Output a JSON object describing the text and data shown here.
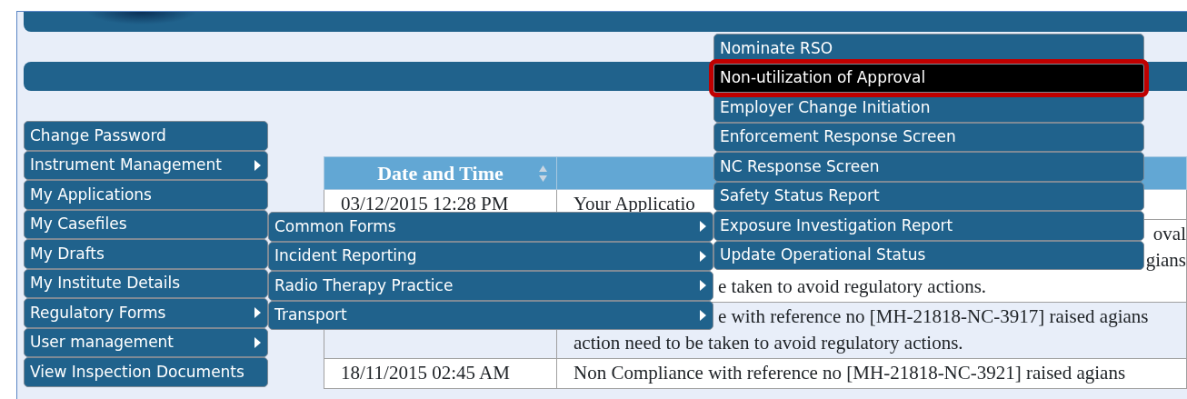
{
  "left_menu": [
    {
      "label": "Change Password",
      "has_submenu": false
    },
    {
      "label": "Instrument Management",
      "has_submenu": true
    },
    {
      "label": "My Applications",
      "has_submenu": false
    },
    {
      "label": "My Casefiles",
      "has_submenu": false
    },
    {
      "label": "My Drafts",
      "has_submenu": false
    },
    {
      "label": "My Institute Details",
      "has_submenu": false
    },
    {
      "label": "Regulatory Forms",
      "has_submenu": true
    },
    {
      "label": "User management",
      "has_submenu": true
    },
    {
      "label": "View Inspection Documents",
      "has_submenu": false
    }
  ],
  "submenu": [
    {
      "label": "Common Forms",
      "has_submenu": true
    },
    {
      "label": "Incident Reporting",
      "has_submenu": true
    },
    {
      "label": "Radio Therapy Practice",
      "has_submenu": true
    },
    {
      "label": "Transport",
      "has_submenu": true
    }
  ],
  "flyout": [
    {
      "label": "Nominate RSO",
      "selected": false
    },
    {
      "label": "Non-utilization of Approval",
      "selected": true
    },
    {
      "label": "Employer Change Initiation",
      "selected": false
    },
    {
      "label": "Enforcement Response Screen",
      "selected": false
    },
    {
      "label": "NC Response Screen",
      "selected": false
    },
    {
      "label": "Safety Status Report",
      "selected": false
    },
    {
      "label": "Exposure Investigation Report",
      "selected": false
    },
    {
      "label": "Update Operational Status",
      "selected": false
    }
  ],
  "table": {
    "columns": [
      {
        "label": "Date and Time",
        "sortable": true
      }
    ],
    "rows": [
      {
        "date": "03/12/2015 12:28 PM",
        "shaded": false,
        "message_lines": [
          {
            "kind": "full",
            "text": "Your Applicatio"
          }
        ]
      },
      {
        "shaded": false,
        "message_lines": [
          {
            "kind": "end",
            "text": "oval"
          },
          {
            "kind": "end",
            "text": "gians"
          },
          {
            "kind": "after_menu",
            "text": "e taken to avoid regulatory actions."
          }
        ]
      },
      {
        "shaded": true,
        "message_lines": [
          {
            "kind": "after_menu",
            "text": "e with reference no [MH-21818-NC-3917] raised agians"
          },
          {
            "kind": "full",
            "text": "action need to be taken to avoid regulatory actions."
          }
        ]
      },
      {
        "date": "18/11/2015 02:45 AM",
        "shaded": false,
        "message_lines": [
          {
            "kind": "full",
            "text": "Non Compliance with reference no [MH-21818-NC-3921] raised agians"
          }
        ]
      }
    ]
  }
}
